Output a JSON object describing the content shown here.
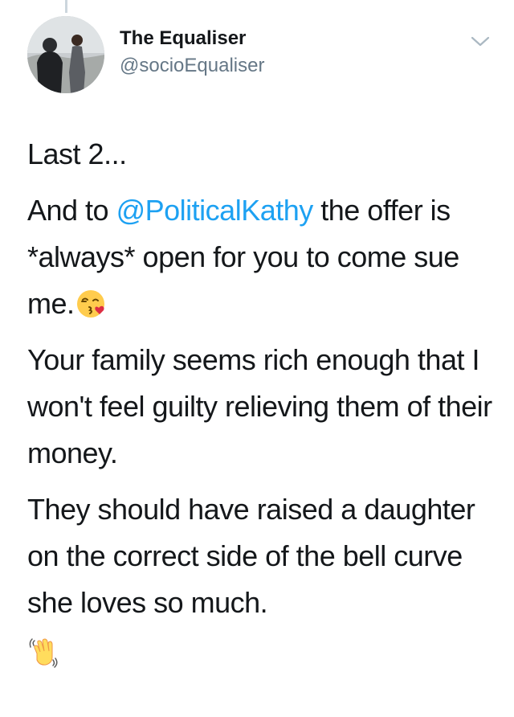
{
  "tweet": {
    "display_name": "The Equaliser",
    "handle": "@socioEqualiser",
    "avatar_icon": "profile-photo",
    "menu_icon": "chevron-down-icon",
    "paragraphs": {
      "p1": "Last 2...",
      "p2": {
        "before": "And to ",
        "mention": "@PoliticalKathy",
        "after": " the offer is *always* open for you to come sue me.",
        "emoji": "face-blowing-a-kiss"
      },
      "p3": "Your family seems rich enough that I won't feel guilty relieving them of their money.",
      "p4": "They should have raised a daughter on the correct side of the bell curve she loves so much.",
      "closing_emoji": "waving-hand"
    },
    "colors": {
      "link": "#1da1f2",
      "text": "#14171a",
      "secondary": "#657786"
    }
  }
}
